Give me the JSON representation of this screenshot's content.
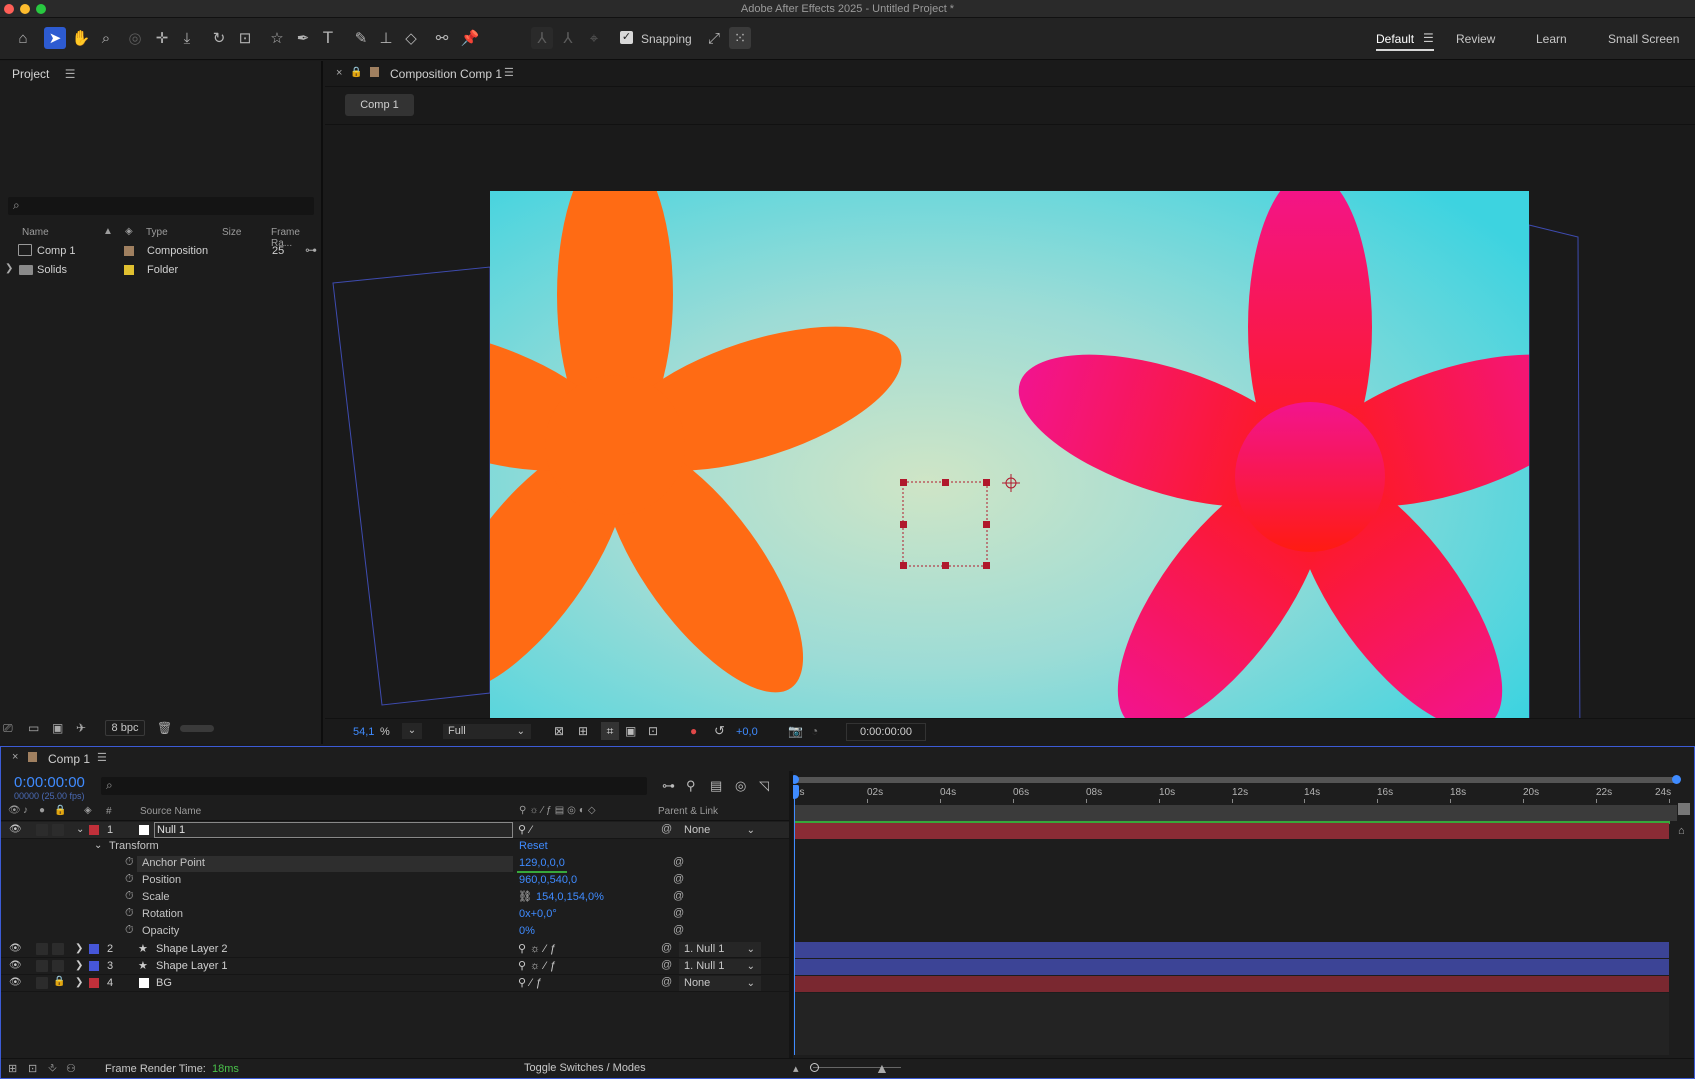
{
  "window": {
    "title": "Adobe After Effects 2025 - Untitled Project *"
  },
  "toolbar": {
    "snapping_label": "Snapping",
    "workspaces": [
      "Default",
      "Review",
      "Learn",
      "Small Screen"
    ]
  },
  "project": {
    "panel_title": "Project",
    "columns": {
      "name": "Name",
      "type": "Type",
      "size": "Size",
      "frame_rate": "Frame Ra..."
    },
    "items": [
      {
        "name": "Comp 1",
        "type": "Composition",
        "size": "",
        "frame_rate": "25",
        "label_color": "#a08060"
      },
      {
        "name": "Solids",
        "type": "Folder",
        "size": "",
        "frame_rate": "",
        "label_color": "#e0c030"
      }
    ],
    "bpc": "8 bpc"
  },
  "viewer": {
    "tab_title": "Composition Comp 1",
    "comp_chip": "Comp 1",
    "zoom": "54,1",
    "zoom_unit": "%",
    "resolution": "Full",
    "exposure": "+0,0",
    "timecode": "0:00:00:00"
  },
  "timeline": {
    "tab_title": "Comp 1",
    "timecode": "0:00:00:00",
    "fps_note": "00000 (25.00 fps)",
    "columns": {
      "num": "#",
      "source_name": "Source Name",
      "parent": "Parent & Link"
    },
    "ruler": [
      "0s",
      "02s",
      "04s",
      "06s",
      "08s",
      "10s",
      "12s",
      "14s",
      "16s",
      "18s",
      "20s",
      "22s",
      "24s"
    ],
    "layers": [
      {
        "num": "1",
        "name": "Null 1",
        "parent": "None",
        "label_color": "#c0303a",
        "bar_color": "#8a2b35"
      },
      {
        "num": "2",
        "name": "Shape Layer 2",
        "parent": "1. Null 1",
        "label_color": "#4656d8",
        "bar_color": "#3c4496"
      },
      {
        "num": "3",
        "name": "Shape Layer 1",
        "parent": "1. Null 1",
        "label_color": "#4656d8",
        "bar_color": "#3c4496"
      },
      {
        "num": "4",
        "name": "BG",
        "parent": "None",
        "label_color": "#c0303a",
        "bar_color": "#7a2830"
      }
    ],
    "transform": {
      "group_label": "Transform",
      "reset_label": "Reset",
      "props": [
        {
          "label": "Anchor Point",
          "value": "129,0,0,0"
        },
        {
          "label": "Position",
          "value": "960,0,540,0"
        },
        {
          "label": "Scale",
          "value": "154,0,154,0%"
        },
        {
          "label": "Rotation",
          "value": "0x+0,0°"
        },
        {
          "label": "Opacity",
          "value": "0%"
        }
      ]
    },
    "footer": {
      "render_label": "Frame Render Time:",
      "render_value": "18ms",
      "toggle_label": "Toggle Switches / Modes"
    }
  },
  "colors": {
    "accent": "#2d5bd1",
    "timecode": "#3f8bff",
    "render_value": "#49c04a"
  }
}
